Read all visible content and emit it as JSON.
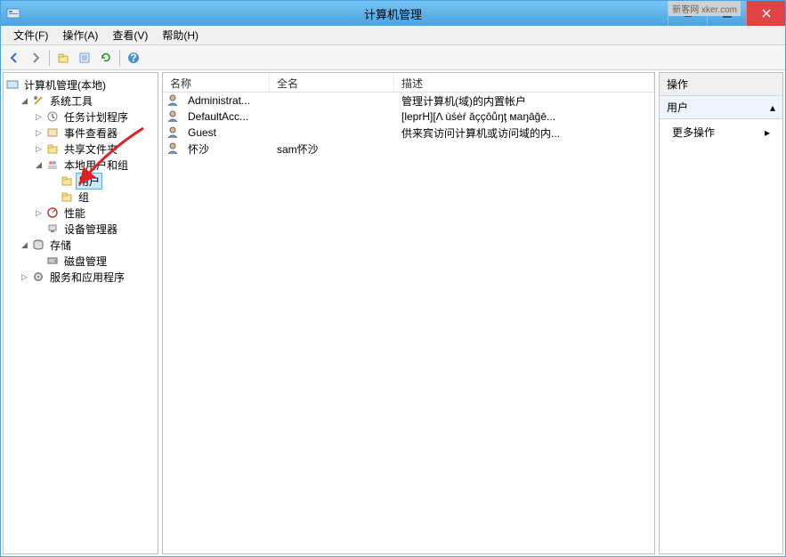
{
  "window": {
    "title": "计算机管理",
    "watermark": "新客网 xker.com"
  },
  "menu": {
    "file": "文件(F)",
    "action": "操作(A)",
    "view": "查看(V)",
    "help": "帮助(H)"
  },
  "tree": {
    "root": "计算机管理(本地)",
    "system_tools": "系统工具",
    "task_scheduler": "任务计划程序",
    "event_viewer": "事件查看器",
    "shared_folders": "共享文件夹",
    "local_users": "本地用户和组",
    "users": "用户",
    "groups": "组",
    "performance": "性能",
    "device_manager": "设备管理器",
    "storage": "存储",
    "disk_management": "磁盘管理",
    "services_apps": "服务和应用程序"
  },
  "list": {
    "columns": {
      "name": "名称",
      "full": "全名",
      "desc": "描述"
    },
    "rows": [
      {
        "name": "Administrat...",
        "full": "",
        "desc": "管理计算机(域)的内置帐户"
      },
      {
        "name": "DefaultAcc...",
        "full": "",
        "desc": "[leprH][Λ ùśėŕ ăççôůŋţ мaŋāğē..."
      },
      {
        "name": "Guest",
        "full": "",
        "desc": "供来宾访问计算机或访问域的内..."
      },
      {
        "name": "怀沙",
        "full": "sam怀沙",
        "desc": ""
      }
    ]
  },
  "actions": {
    "header": "操作",
    "section": "用户",
    "more": "更多操作"
  }
}
